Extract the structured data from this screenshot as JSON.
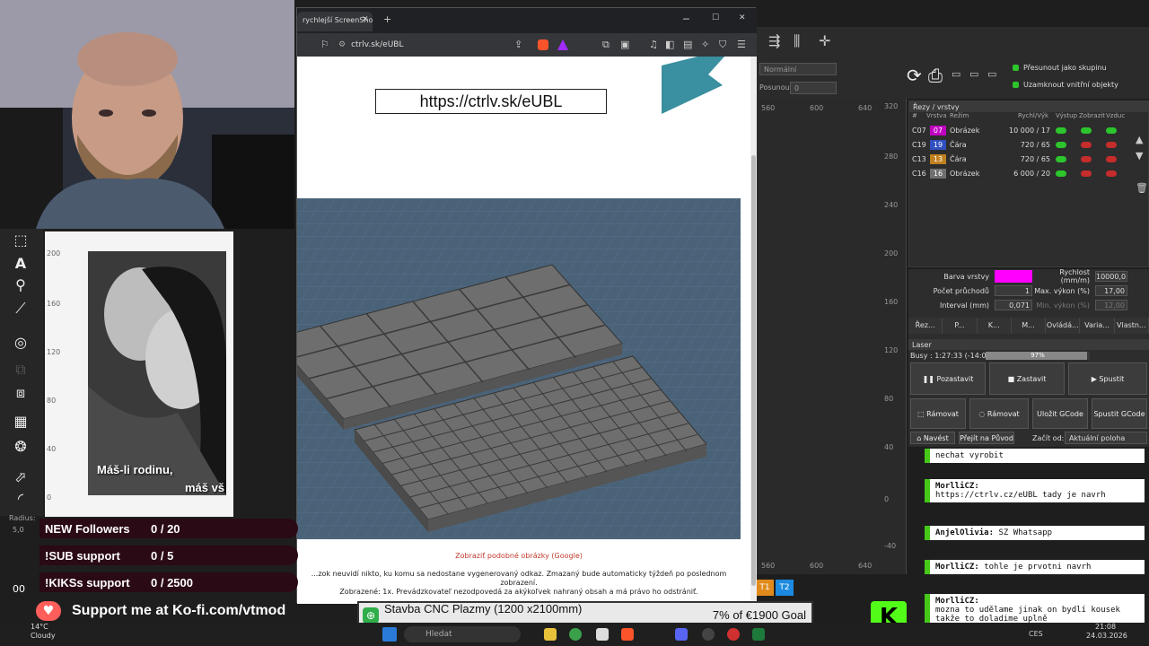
{
  "browser": {
    "tab_title": "rychlejší ScreenShot",
    "url": "ctrlv.sk/eUBL",
    "page_url_box": "https://ctrlv.sk/eUBL",
    "similar_link": "Zobraziť podobné obrázky (Google)",
    "disclaimer_line1": "...zok neuvidí nikto, ku komu sa nedostane vygenerovaný odkaz. Zmazaný bude automaticky týždeň po poslednom zobrazení.",
    "disclaimer_line2": "Zobrazené: 1x. Prevádzkovateľ nezodpovedá za akýkoľvek nahraný obsah a má právo ho odstrániť."
  },
  "lightburn": {
    "mode_select": "Normální",
    "offset_label": "Posunout",
    "offset_value": "0",
    "move_as_group": "Přesunout jako skupinu",
    "lock_inner": "Uzamknout vnitřní objekty",
    "layers_title": "Řezy / vrstvy",
    "layer_headers": [
      "#",
      "Vrstva",
      "Režim",
      "Rychl/Výk",
      "Výstup",
      "Zobrazit",
      "Vzduc"
    ],
    "layers": [
      {
        "id": "C07",
        "num": "07",
        "color": "#c000c0",
        "mode": "Obrázek",
        "speed": "10 000 / 17"
      },
      {
        "id": "C19",
        "num": "19",
        "color": "#3050c0",
        "mode": "Čára",
        "speed": "720 / 65"
      },
      {
        "id": "C13",
        "num": "13",
        "color": "#c08020",
        "mode": "Čára",
        "speed": "720 / 65"
      },
      {
        "id": "C16",
        "num": "16",
        "color": "#707070",
        "mode": "Obrázek",
        "speed": "6 000 / 20"
      }
    ],
    "props": {
      "layer_color_label": "Barva vrstvy",
      "speed_label": "Rychlost (mm/m)",
      "speed_value": "10000,0",
      "passes_label": "Počet průchodů",
      "passes_value": "1",
      "max_power_label": "Max. výkon (%)",
      "max_power_value": "17,00",
      "interval_label": "Interval (mm)",
      "interval_value": "0,071",
      "min_power_label": "Min. výkon (%)",
      "min_power_value": "12,00"
    },
    "tabs": [
      "Řez...",
      "P...",
      "K...",
      "M...",
      "Ovládá...",
      "Varia...",
      "Vlastn..."
    ],
    "laser": {
      "title": "Laser",
      "busy": "Busy : 1:27:33 (-14:08)",
      "progress_text": "97%",
      "progress": 0.97,
      "pause": "Pozastavit",
      "stop": "Zastavit",
      "start": "Spustit",
      "frame1": "Rámovat",
      "frame2": "Rámovat",
      "save_gcode": "Uložit GCode",
      "run_gcode": "Spustit GCode",
      "home": "Navést",
      "goto_origin": "Přejít na Původ",
      "start_from_label": "Začít od:",
      "start_from_value": "Aktuální poloha"
    },
    "ruler_left": [
      "560",
      "600",
      "640"
    ],
    "ruler_right": [
      "320",
      "280",
      "240",
      "200",
      "160",
      "120",
      "80",
      "40",
      "0",
      "-40"
    ],
    "bottom_ruler": [
      "560",
      "600",
      "640"
    ],
    "tabs_t": [
      "T1",
      "T2"
    ]
  },
  "photo_panel": {
    "ruler": [
      "200",
      "160",
      "120",
      "80",
      "40",
      "0"
    ],
    "text_line1": "Máš-li rodinu,",
    "text_line2": "máš vš"
  },
  "tools_panel": {
    "radius_label": "Radius:",
    "radius_value": "5,0",
    "time": "00"
  },
  "overlay": {
    "goals": [
      {
        "label": "NEW Followers",
        "count": "0 / 20"
      },
      {
        "label": "!SUB support",
        "count": "0 / 5"
      },
      {
        "label": "!KIKSs support",
        "count": "0 / 2500"
      }
    ],
    "kofi": "Support me at Ko-fi.com/vtmod",
    "donation_title": "Stavba CNC Plazmy (1200 x2100mm)",
    "donation_goal": "7% of €1900 Goal"
  },
  "chat": [
    {
      "user": "",
      "text": "nechat vyrobit"
    },
    {
      "user": "MorlliCZ:",
      "text": "https://ctrlv.cz/eUBL tady je navrh"
    },
    {
      "user": "AnjelOlivia:",
      "text": "SZ Whatsapp"
    },
    {
      "user": "MorlliCZ:",
      "text": "tohle je prvotni navrh"
    },
    {
      "user": "MorlliCZ:",
      "text": "mozna to udělame jinak on bydlí kousek takže to doladime uplně"
    }
  ],
  "taskbar": {
    "weather_temp": "14°C",
    "weather_desc": "Cloudy",
    "search": "Hledat",
    "time": "21:08",
    "date": "24.03.2026",
    "lang": "CES"
  }
}
